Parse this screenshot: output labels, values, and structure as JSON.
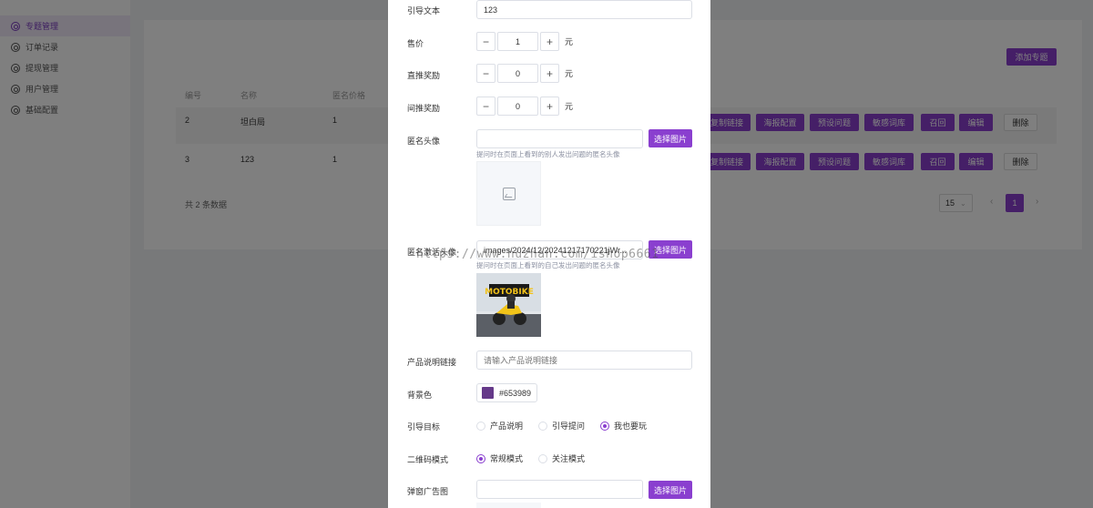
{
  "sidebar": {
    "items": [
      {
        "label": "专题管理",
        "active": true
      },
      {
        "label": "订单记录",
        "active": false
      },
      {
        "label": "提现管理",
        "active": false
      },
      {
        "label": "用户管理",
        "active": false
      },
      {
        "label": "基础配置",
        "active": false
      }
    ]
  },
  "toolbar": {
    "add_label": "添加专题"
  },
  "table": {
    "headers": [
      "编号",
      "名称",
      "匿名价格"
    ],
    "rows": [
      {
        "id": "2",
        "name": "坦白局",
        "price": "1"
      },
      {
        "id": "3",
        "name": "123",
        "price": "1"
      }
    ],
    "actions": [
      "复制链接",
      "海报配置",
      "预设问题",
      "敏感词库",
      "召回",
      "编辑"
    ],
    "delete_label": "删除"
  },
  "pagination": {
    "total_text": "共 2 条数据",
    "page_size": "15",
    "current_page": "1"
  },
  "dialog": {
    "guide_text": {
      "label": "引导文本",
      "value": "123"
    },
    "price": {
      "label": "售价",
      "value": "1",
      "unit": "元"
    },
    "direct_reward": {
      "label": "直推奖励",
      "value": "0",
      "unit": "元"
    },
    "indirect_reward": {
      "label": "间推奖励",
      "value": "0",
      "unit": "元"
    },
    "anon_avatar": {
      "label": "匿名头像",
      "value": "",
      "button": "选择图片",
      "hint": "提问时在页面上看到的别人发出问题的匿名头像"
    },
    "anon_active_avatar": {
      "label": "匿名激活头像",
      "value": "images/2024/12/20241217170221jWr...",
      "button": "选择图片",
      "hint": "提问时在页面上看到的自己发出问题的匿名头像"
    },
    "product_link": {
      "label": "产品说明链接",
      "placeholder": "请输入产品说明链接"
    },
    "bg_color": {
      "label": "背景色",
      "value": "#653989"
    },
    "guide_target": {
      "label": "引导目标",
      "options": [
        "产品说明",
        "引导提问",
        "我也要玩"
      ],
      "selected": "我也要玩"
    },
    "qr_mode": {
      "label": "二维码模式",
      "options": [
        "常规模式",
        "关注模式"
      ],
      "selected": "常规模式"
    },
    "popup_ad": {
      "label": "弹窗广告图",
      "value": "",
      "button": "选择图片"
    }
  },
  "watermark": "https://www.huzhan.com/ishop6661",
  "colors": {
    "accent": "#8a3fcf",
    "bg_swatch": "#653989"
  }
}
